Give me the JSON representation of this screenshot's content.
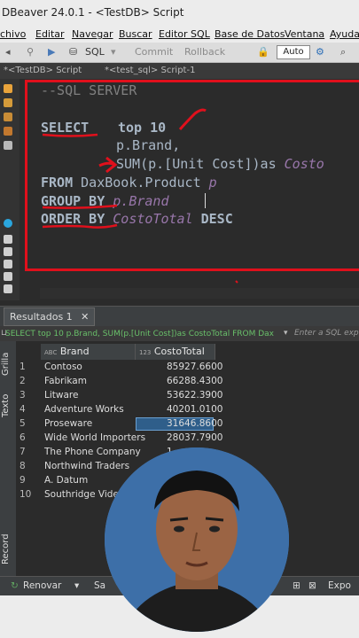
{
  "window": {
    "title": "DBeaver 24.0.1 - <TestDB> Script"
  },
  "menu": [
    "chivo",
    "Editar",
    "Navegar",
    "Buscar",
    "Editor SQL",
    "Base de Datos",
    "Ventana",
    "Ayuda"
  ],
  "toolbar": {
    "sql": "SQL",
    "commit": "Commit",
    "rollback": "Rollback",
    "auto": "Auto"
  },
  "editor_tabs": {
    "tab1": "*<TestDB> Script",
    "tab2": "*<test_sql> Script-1"
  },
  "code": {
    "comment": "--SQL SERVER",
    "select": "SELECT",
    "top": "top 10",
    "line2": "p.Brand,",
    "line3a": "SUM(p.[Unit Cost])as ",
    "line3b": "Costo",
    "from": "FROM",
    "table": " DaxBook.Product ",
    "alias": "p",
    "groupby": "GROUP BY",
    "groupcol": " p.Brand",
    "orderby": "ORDER BY",
    "ordercol": " CostoTotal",
    "desc": " DESC"
  },
  "results": {
    "tab_label": "Resultados 1",
    "filter_text": "SELECT top 10 p.Brand, SUM(p.[Unit Cost])as CostoTotal FROM Dax",
    "filter_hint": "Enter a SQL expr",
    "vertical_tabs": [
      "Grilla",
      "Texto",
      "Record"
    ],
    "columns": [
      "Brand",
      "CostoTotal"
    ],
    "col_prefix": [
      "ABC",
      "123"
    ],
    "rows": [
      {
        "n": "1",
        "brand": "Contoso",
        "cost": "85927.6600"
      },
      {
        "n": "2",
        "brand": "Fabrikam",
        "cost": "66288.4300"
      },
      {
        "n": "3",
        "brand": "Litware",
        "cost": "53622.3900"
      },
      {
        "n": "4",
        "brand": "Adventure Works",
        "cost": "40201.0100"
      },
      {
        "n": "5",
        "brand": "Proseware",
        "cost": "31646.8600"
      },
      {
        "n": "6",
        "brand": "Wide World Importers",
        "cost": "28037.7900"
      },
      {
        "n": "7",
        "brand": "The Phone Company",
        "cost": "1"
      },
      {
        "n": "8",
        "brand": "Northwind Traders",
        "cost": ""
      },
      {
        "n": "9",
        "brand": "A. Datum",
        "cost": ""
      },
      {
        "n": "10",
        "brand": "Southridge Video",
        "cost": ""
      }
    ],
    "selected_row": 5
  },
  "bottom": {
    "refresh": "Renovar",
    "save": "Sa",
    "export": "Expo"
  },
  "colors": {
    "accent_red": "#e0101c",
    "sql_green": "#69c06a",
    "selection": "#2f5e8a"
  }
}
